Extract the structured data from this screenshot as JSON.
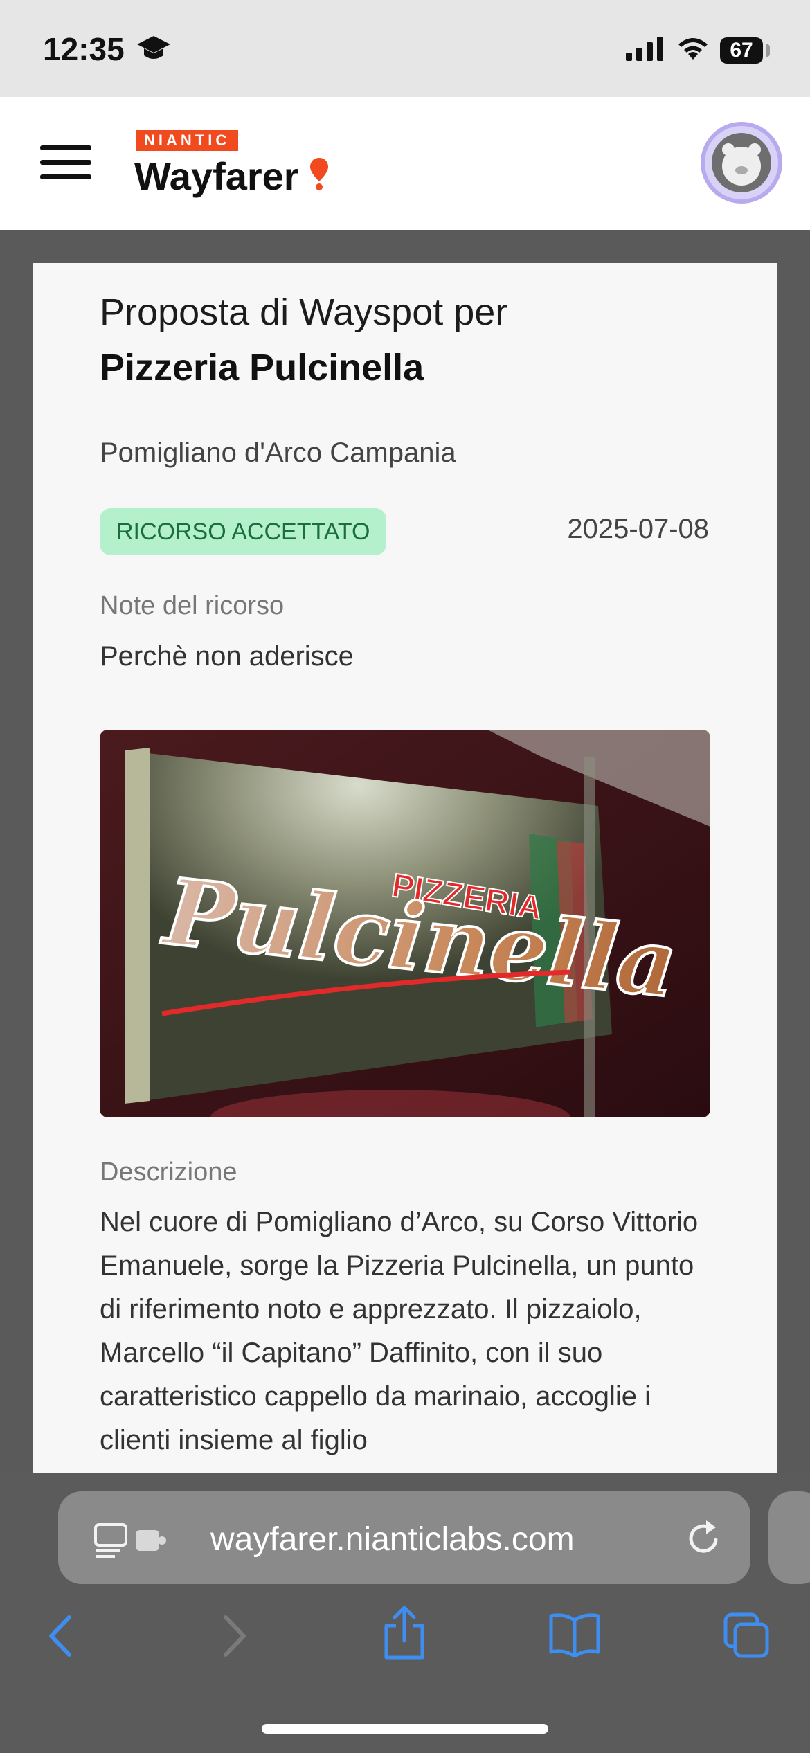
{
  "status_bar": {
    "time": "12:35",
    "battery": "67"
  },
  "header": {
    "brand_tag": "NIANTIC",
    "brand_name": "Wayfarer"
  },
  "proposal": {
    "title_prefix": "Proposta di Wayspot per",
    "name": "Pizzeria Pulcinella",
    "location": "Pomigliano d'Arco Campania",
    "status_badge": "RICORSO ACCETTATO",
    "date": "2025-07-08",
    "notes_label": "Note del ricorso",
    "notes_text": "Perchè non aderisce",
    "sign_small_text": "PIZZERIA",
    "sign_script_text": "Pulcinella",
    "description_label": "Descrizione",
    "description_text": "Nel cuore di Pomigliano d’Arco, su Corso Vittorio Emanuele, sorge la Pizzeria Pulcinella, un punto di riferimento noto e apprezzato. Il pizzaiolo, Marcello “il Capitano” Daffinito, con il suo caratteristico cappello da marinaio, accoglie i clienti insieme al figlio"
  },
  "browser": {
    "url": "wayfarer.nianticlabs.com"
  },
  "colors": {
    "brand_orange": "#f04a1e",
    "badge_bg": "#b5f0cc",
    "badge_text": "#1a6e3c",
    "toolbar_blue": "#3d8ef0"
  }
}
